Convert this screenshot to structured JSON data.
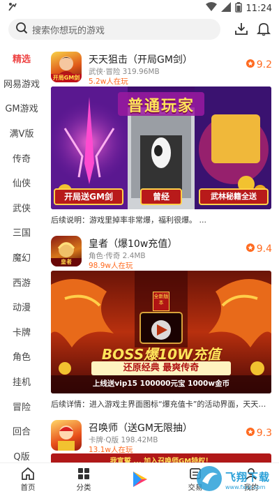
{
  "status_bar": {
    "time": "11:24"
  },
  "search": {
    "placeholder": "搜索你想玩的游戏"
  },
  "sidebar": {
    "items": [
      {
        "label": "精选",
        "active": true
      },
      {
        "label": "网易游戏"
      },
      {
        "label": "GM游戏"
      },
      {
        "label": "满V版"
      },
      {
        "label": "传奇"
      },
      {
        "label": "仙侠"
      },
      {
        "label": "武侠"
      },
      {
        "label": "三国"
      },
      {
        "label": "魔幻"
      },
      {
        "label": "西游"
      },
      {
        "label": "动漫"
      },
      {
        "label": "卡牌"
      },
      {
        "label": "角色"
      },
      {
        "label": "挂机"
      },
      {
        "label": "冒险"
      },
      {
        "label": "回合"
      },
      {
        "label": "Q版"
      }
    ]
  },
  "games": [
    {
      "title": "天天狙击（开局GM剑）",
      "meta": "武侠·冒险  319.96MB",
      "players": "5.2w人在玩",
      "rating": "9.2",
      "icon_label": "开局GM剑",
      "banner": {
        "headline": "普通玩家",
        "tags": [
          "开局送GM剑",
          "曾经",
          "武林秘籍全送"
        ]
      },
      "desc": "后续说明：游戏里掉率非常爆，福利很爆。 ..."
    },
    {
      "title": "皇者（爆10w充值）",
      "meta": "角色·传奇  2.4MB",
      "players": "98.9w人在玩",
      "rating": "9.4",
      "icon_label": "皇者",
      "banner": {
        "seal": "全新版本",
        "headline": "BOSS爆10W充值",
        "sub": "还原经典  最爽传奇",
        "strip": "上线送vip15  100000元宝  1000w金币"
      },
      "desc": "后续详情：进入游戏主界面图标“爆充值卡”的活动界面，天天打B..."
    },
    {
      "title": "召唤师（送GM无限抽）",
      "meta": "卡牌·Q版  198.42MB",
      "players": "13.1w人在玩",
      "rating": "9.3",
      "banner_strip": "我宣誓 ... 加入召唤师GM特权！"
    }
  ],
  "bottom_nav": {
    "items": [
      {
        "label": "首页"
      },
      {
        "label": "分类"
      },
      {
        "label": ""
      },
      {
        "label": "交易"
      },
      {
        "label": "我的"
      }
    ]
  },
  "watermark": {
    "text": "飞翔下载",
    "sub": "www.fxxz.com"
  },
  "colors": {
    "accent": "#e44444",
    "orange": "#ff6a1f"
  }
}
